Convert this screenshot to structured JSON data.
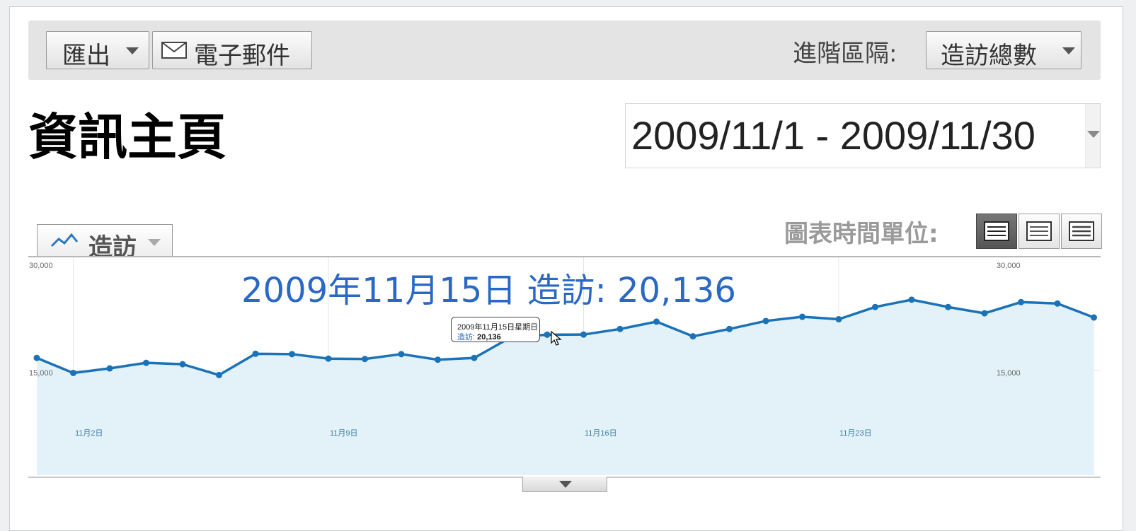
{
  "toolbar": {
    "export_label": "匯出",
    "email_label": "電子郵件",
    "segment_label": "進階區隔:",
    "segment_value": "造訪總數"
  },
  "page_title": "資訊主頁",
  "date_range": "2009/11/1 - 2009/11/30",
  "metric_selector": "造訪",
  "time_unit_label": "圖表時間單位:",
  "time_unit_buttons": [
    "day",
    "week",
    "month"
  ],
  "hover_caption": "2009年11月15日 造訪: 20,136",
  "tooltip": {
    "date": "2009年11月15日星期日",
    "metric": "造訪",
    "value": "20,136"
  },
  "colors": {
    "line": "#1a72b8",
    "fill": "#e3f1f9",
    "caption": "#2a68c6"
  },
  "chart_data": {
    "type": "area",
    "y_ticks_left": [
      "30,000",
      "15,000"
    ],
    "y_ticks_right": [
      "30,000",
      "15,000"
    ],
    "ylim": [
      0,
      30000
    ],
    "x_tick_labels": [
      "11月2日",
      "11月9日",
      "11月16日",
      "11月23日"
    ],
    "x_tick_days": [
      2,
      9,
      16,
      23
    ],
    "series": [
      {
        "name": "造訪",
        "x": [
          1,
          2,
          3,
          4,
          5,
          6,
          7,
          8,
          9,
          10,
          11,
          12,
          13,
          14,
          15,
          16,
          17,
          18,
          19,
          20,
          21,
          22,
          23,
          24,
          25,
          26,
          27,
          28,
          29,
          30
        ],
        "values": [
          16800,
          14650,
          15300,
          16100,
          15900,
          14350,
          17400,
          17350,
          16700,
          16650,
          17350,
          16550,
          16800,
          19750,
          20136,
          20150,
          20950,
          22000,
          19900,
          20950,
          22100,
          22700,
          22350,
          24100,
          25150,
          24100,
          23200,
          24800,
          24600,
          22600
        ]
      }
    ]
  }
}
